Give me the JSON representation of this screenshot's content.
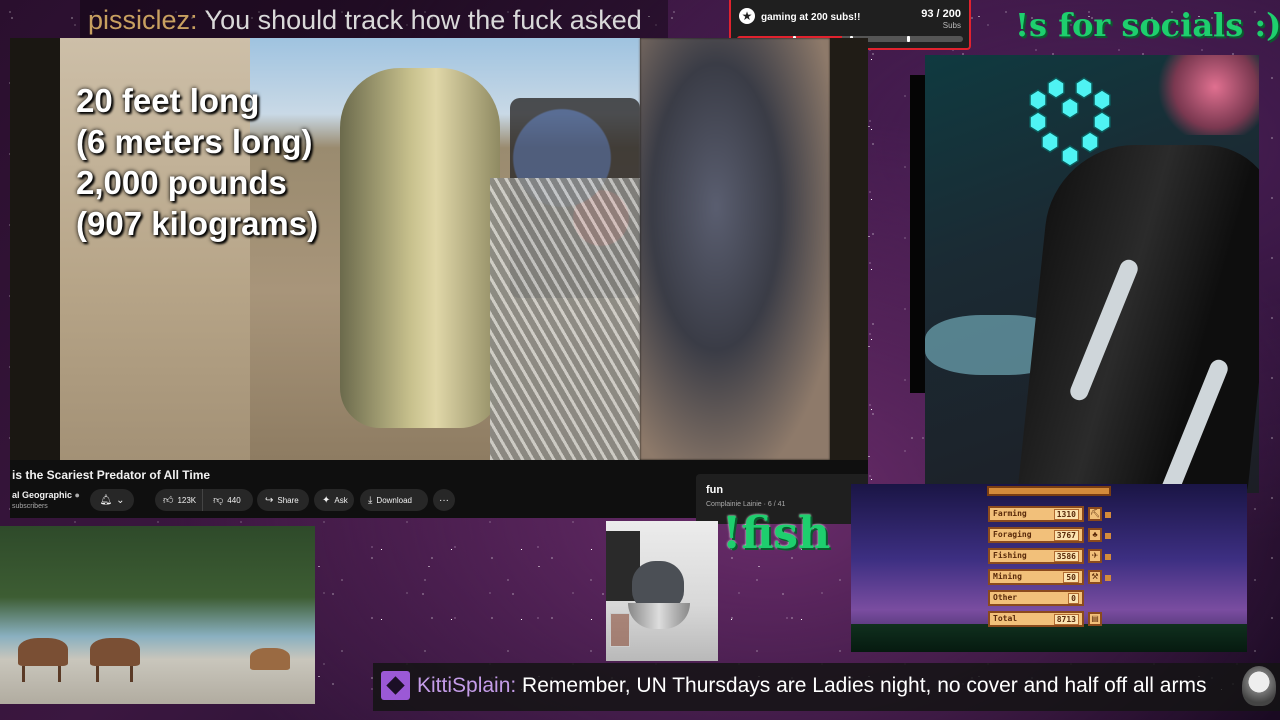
{
  "top_chat": {
    "username": "pissiclez:",
    "message": " You should track how the fuck asked"
  },
  "sub_goal": {
    "title": "gaming at 200 subs!!",
    "current": "93 / 200",
    "unit": "Subs",
    "progress": 0.465,
    "accent": "#e0222e"
  },
  "socials_command": "!s for socials :)",
  "youtube": {
    "overlay_lines": [
      "20 feet long",
      "(6 meters long)",
      "2,000 pounds",
      "(907 kilograms)"
    ],
    "title": "is the Scariest Predator of All Time",
    "channel": "al Geographic",
    "subscribers": "subscribers",
    "likes": "123K",
    "dislikes": "440",
    "share": "Share",
    "ask": "Ask",
    "download": "Download",
    "icons": {
      "bell": "bell-icon",
      "like": "thumbs-up-icon",
      "dislike": "thumbs-down-icon",
      "share": "share-icon",
      "ask": "sparkle-icon",
      "download": "download-icon",
      "more": "more-icon"
    }
  },
  "fun_panel": {
    "title": "fun",
    "subtitle": "Complainie Lainie · 6 / 41"
  },
  "fish_command": "!fish",
  "stardew_skills": {
    "rows": [
      {
        "name": "Farming",
        "value": "1310"
      },
      {
        "name": "Foraging",
        "value": "3767"
      },
      {
        "name": "Fishing",
        "value": "3586"
      },
      {
        "name": "Mining",
        "value": "50"
      },
      {
        "name": "Other",
        "value": "0"
      },
      {
        "name": "Total",
        "value": "8713"
      }
    ]
  },
  "bottom_chat": {
    "username": "KittiSplain:",
    "message": " Remember, UN Thursdays are Ladies night, no cover and half off all arms",
    "badge_color": "#9b59d6"
  }
}
